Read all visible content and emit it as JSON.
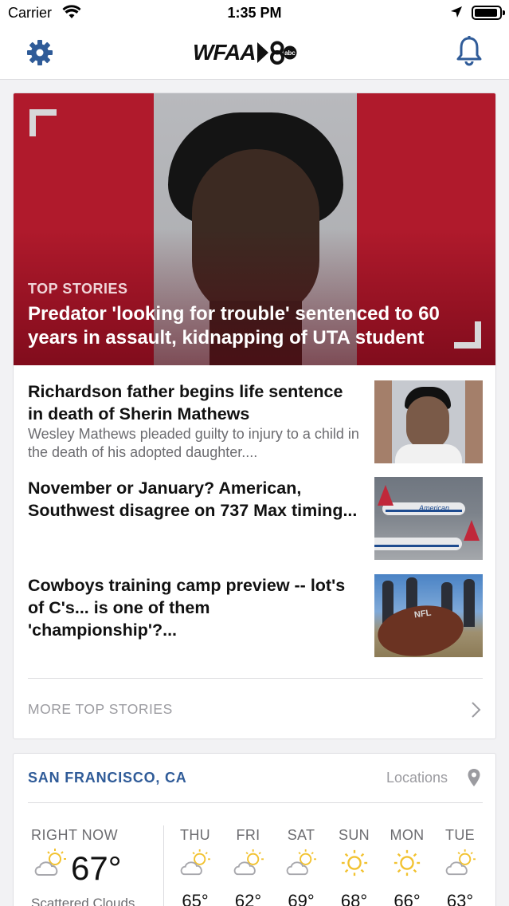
{
  "status_bar": {
    "carrier": "Carrier",
    "time": "1:35 PM"
  },
  "nav": {
    "logo_text": "WFAA",
    "logo_badge": "8",
    "logo_network": "abc"
  },
  "hero": {
    "section": "TOP STORIES",
    "title": "Predator 'looking for trouble' sentenced to 60 years in assault, kidnapping of UTA student"
  },
  "stories": [
    {
      "title": "Richardson father begins life sentence in death of Sherin Mathews",
      "summary": "Wesley Mathews pleaded guilty to injury to a child in the death of his adopted daughter...."
    },
    {
      "title": "November or January? American, Southwest disagree on 737 Max timing...",
      "summary": "",
      "thumb_text": "American"
    },
    {
      "title": "Cowboys training camp preview -- lot's of C's... is one of them 'championship'?...",
      "summary": "",
      "thumb_text": "NFL"
    }
  ],
  "more_stories": {
    "label": "MORE TOP STORIES"
  },
  "weather": {
    "city": "SAN FRANCISCO, CA",
    "locations_label": "Locations",
    "now": {
      "label": "RIGHT NOW",
      "temp": "67°",
      "condition": "Scattered Clouds",
      "icon": "partly-cloudy-icon"
    },
    "days": [
      {
        "name": "THU",
        "temp": "65°",
        "icon": "partly-cloudy-icon"
      },
      {
        "name": "FRI",
        "temp": "62°",
        "icon": "partly-cloudy-icon"
      },
      {
        "name": "SAT",
        "temp": "69°",
        "icon": "partly-cloudy-icon"
      },
      {
        "name": "SUN",
        "temp": "68°",
        "icon": "sun-icon"
      },
      {
        "name": "MON",
        "temp": "66°",
        "icon": "sun-icon"
      },
      {
        "name": "TUE",
        "temp": "63°",
        "icon": "partly-cloudy-icon"
      }
    ]
  },
  "colors": {
    "hero_background": "#b01a2c",
    "city_accent": "#2f5b98",
    "nav_icon": "#2f5b98",
    "sun": "#f2c230"
  }
}
